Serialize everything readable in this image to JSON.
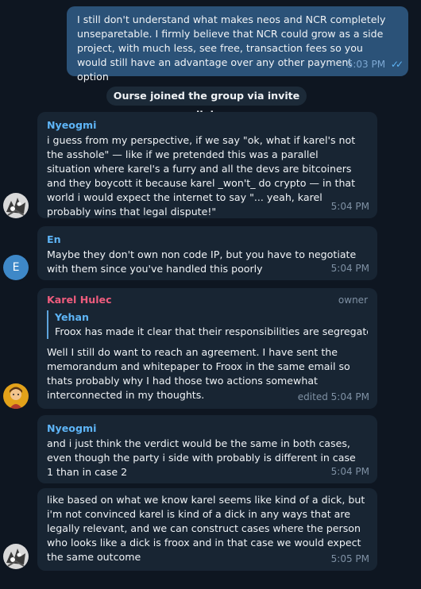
{
  "messages": [
    {
      "sender": "",
      "text": "I still don't understand what makes neos and NCR completely unseparetable. I firmly believe that NCR could grow as a side project, with much less, see free, transaction fees so you would still have an advantage over any other payment option",
      "time": "5:03 PM",
      "ticks": "✓✓"
    },
    {
      "service": "Ourse joined the group via invite link"
    },
    {
      "sender": "Nyeogmi",
      "text": "i guess from my perspective, if we say \"ok, what if karel's not the asshole\" — like if we pretended this was a parallel situation where karel's a furry and all the devs are bitcoiners and they boycott it because karel _won't_ do crypto — in that world i would expect the internet to say \"... yeah, karel probably wins that legal dispute!\"",
      "time": "5:04 PM"
    },
    {
      "sender": "En",
      "avatar_letter": "E",
      "text": "Maybe they don't own non code IP, but you have to negotiate with them since you've handled this poorly",
      "time": "5:04 PM"
    },
    {
      "sender": "Karel Hulec",
      "role": "owner",
      "reply_sender": "Yehan",
      "reply_text": "Froox has made it clear that their responsibilities are segregated ...",
      "text": "Well I still do want to reach an agreement. I have sent the memorandum and whitepaper to Froox in the same email so thats probably why I had those two actions somewhat interconnected in my thoughts.",
      "time": "edited 5:04 PM"
    },
    {
      "sender": "Nyeogmi",
      "text": "and i just think the verdict would be the same in both cases, even though the party i side with probably is different in case 1 than in case 2",
      "time": "5:04 PM"
    },
    {
      "sender": "",
      "text": "like based on what we know karel seems like kind of a dick, but i'm not convinced karel is kind of a dick in any ways that are legally relevant, and we can construct cases where the person who looks like a dick is froox and in that case we would expect the same outcome",
      "time": "5:05 PM"
    }
  ],
  "colors": {
    "background": "#0e1621",
    "incoming_bubble": "#182533",
    "outgoing_bubble": "#2b5278",
    "nyeogmi_name": "#5eb5f7",
    "en_name": "#5eb5f7",
    "karel_name": "#ee5c7d",
    "avatar_en": "#3e88c8"
  },
  "icons": [
    "double-check-icon",
    "nyeogmi-avatar-icon",
    "en-avatar",
    "karel-avatar-icon"
  ]
}
